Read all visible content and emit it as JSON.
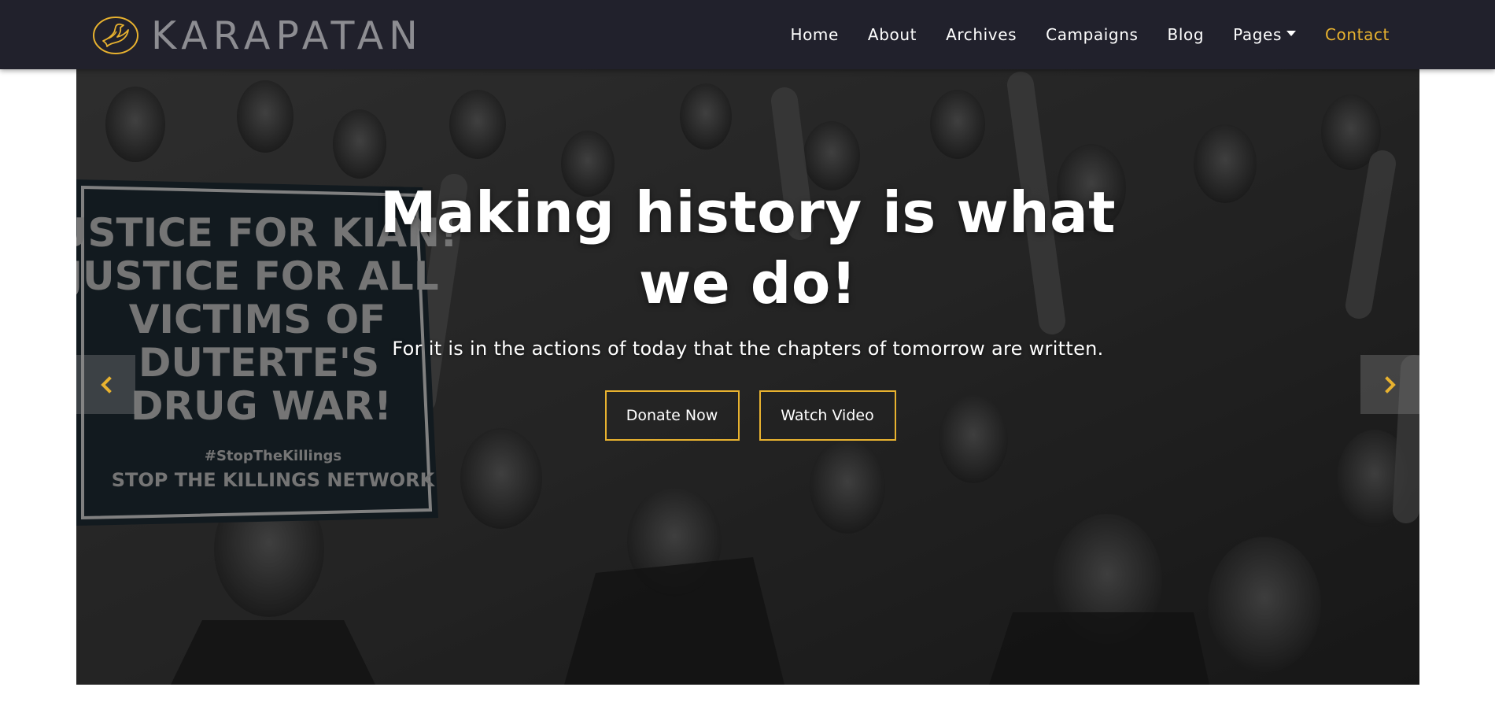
{
  "brand": {
    "name": "KARAPATAN",
    "logo_icon": "dove-in-circle-icon"
  },
  "nav": {
    "items": [
      {
        "label": "Home",
        "active": false
      },
      {
        "label": "About",
        "active": false
      },
      {
        "label": "Archives",
        "active": false
      },
      {
        "label": "Campaigns",
        "active": false
      },
      {
        "label": "Blog",
        "active": false
      },
      {
        "label": "Pages",
        "active": false,
        "dropdown": true
      },
      {
        "label": "Contact",
        "active": true
      }
    ]
  },
  "hero": {
    "title_line1": "Making history is what",
    "title_line2": "we do!",
    "subtitle": "For it is in the actions of today that the chapters of tomorrow are written.",
    "donate_label": "Donate Now",
    "video_label": "Watch Video",
    "prev_icon": "chevron-left-icon",
    "next_icon": "chevron-right-icon",
    "background_image": "protest-crowd-photo"
  },
  "colors": {
    "navbar_bg": "#21212c",
    "accent": "#e8b22f",
    "brand_text": "#8d8d92",
    "nav_text": "#ffffff"
  }
}
